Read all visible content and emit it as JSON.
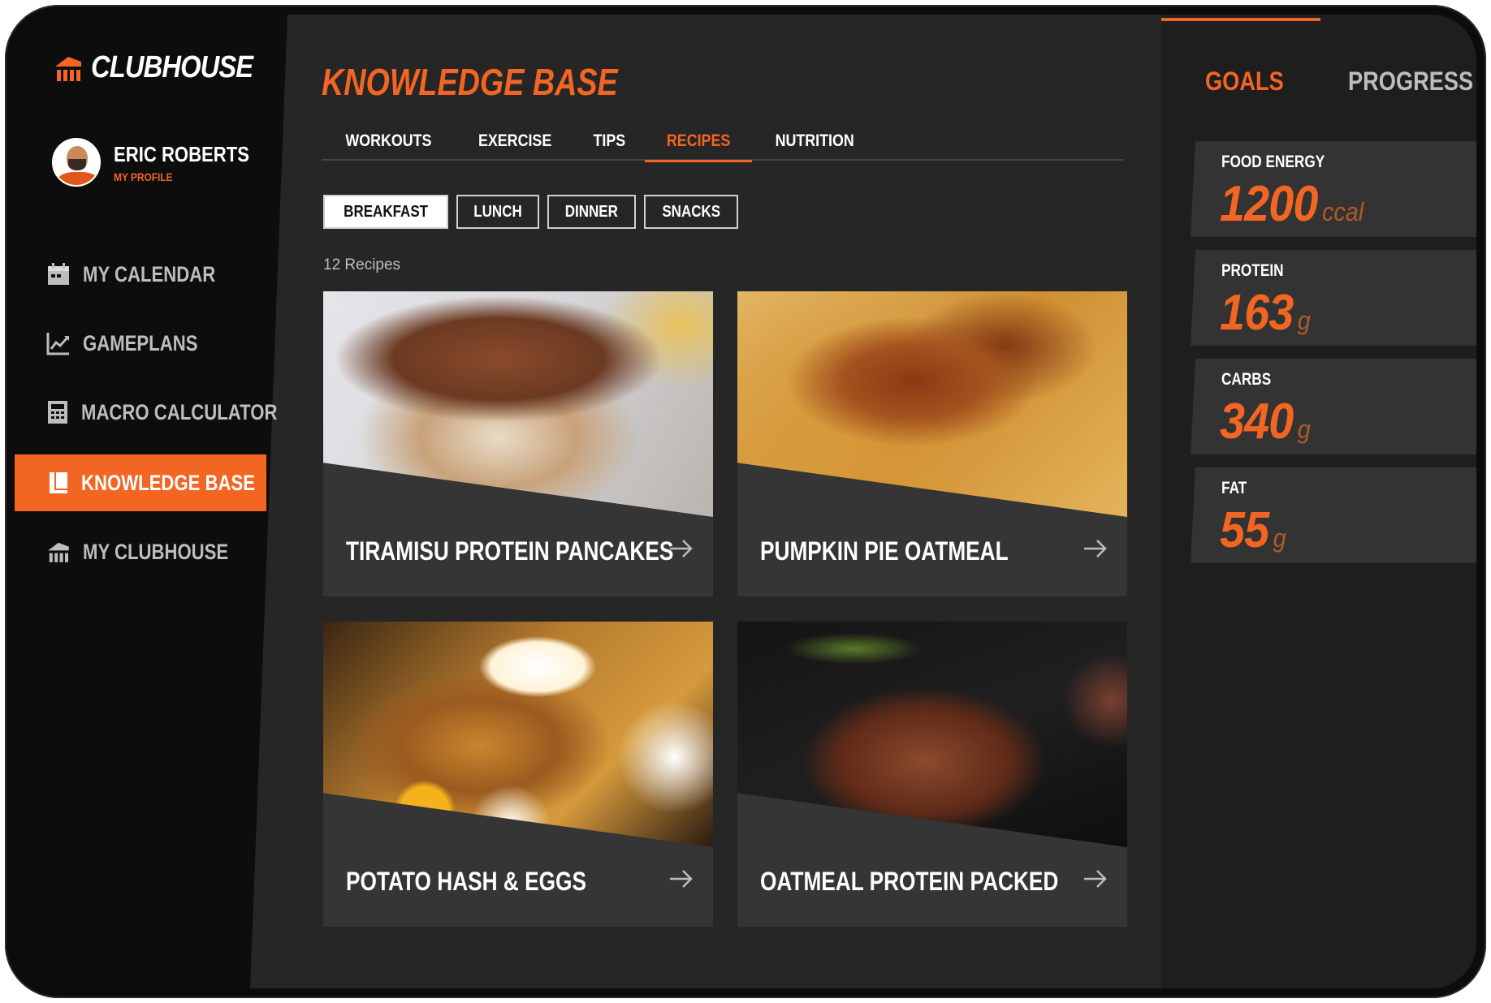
{
  "app": {
    "logo_text": "CLUBHOUSE"
  },
  "profile": {
    "name": "ERIC ROBERTS",
    "link": "MY PROFILE"
  },
  "nav": [
    {
      "label": "MY CALENDAR",
      "icon": "calendar-icon"
    },
    {
      "label": "GAMEPLANS",
      "icon": "chart-line-icon"
    },
    {
      "label": "MACRO CALCULATOR",
      "icon": "calculator-icon"
    },
    {
      "label": "KNOWLEDGE BASE",
      "icon": "book-icon",
      "active": true
    },
    {
      "label": "MY CLUBHOUSE",
      "icon": "clubhouse-icon"
    }
  ],
  "page": {
    "title": "KNOWLEDGE BASE"
  },
  "tabs": [
    "WORKOUTS",
    "EXERCISE",
    "TIPS",
    "RECIPES",
    "NUTRITION"
  ],
  "active_tab": "RECIPES",
  "filters": [
    "BREAKFAST",
    "LUNCH",
    "DINNER",
    "SNACKS"
  ],
  "active_filter": "BREAKFAST",
  "recipe_count": "12 Recipes",
  "recipes": [
    {
      "title": "TIRAMISU PROTEIN PANCAKES"
    },
    {
      "title": "PUMPKIN PIE OATMEAL"
    },
    {
      "title": "POTATO HASH & EGGS"
    },
    {
      "title": "OATMEAL PROTEIN PACKED"
    }
  ],
  "right_panel": {
    "tabs": [
      "GOALS",
      "PROGRESS"
    ],
    "active_tab": "GOALS",
    "stats": [
      {
        "label": "FOOD ENERGY",
        "value": "1200",
        "unit": "ccal"
      },
      {
        "label": "PROTEIN",
        "value": "163",
        "unit": "g"
      },
      {
        "label": "CARBS",
        "value": "340",
        "unit": "g"
      },
      {
        "label": "FAT",
        "value": "55",
        "unit": "g"
      }
    ]
  },
  "colors": {
    "accent": "#f26522",
    "sidebar": "#0d0d0d",
    "main": "#262626",
    "panel": "#1e1e1e",
    "card": "#353535"
  }
}
